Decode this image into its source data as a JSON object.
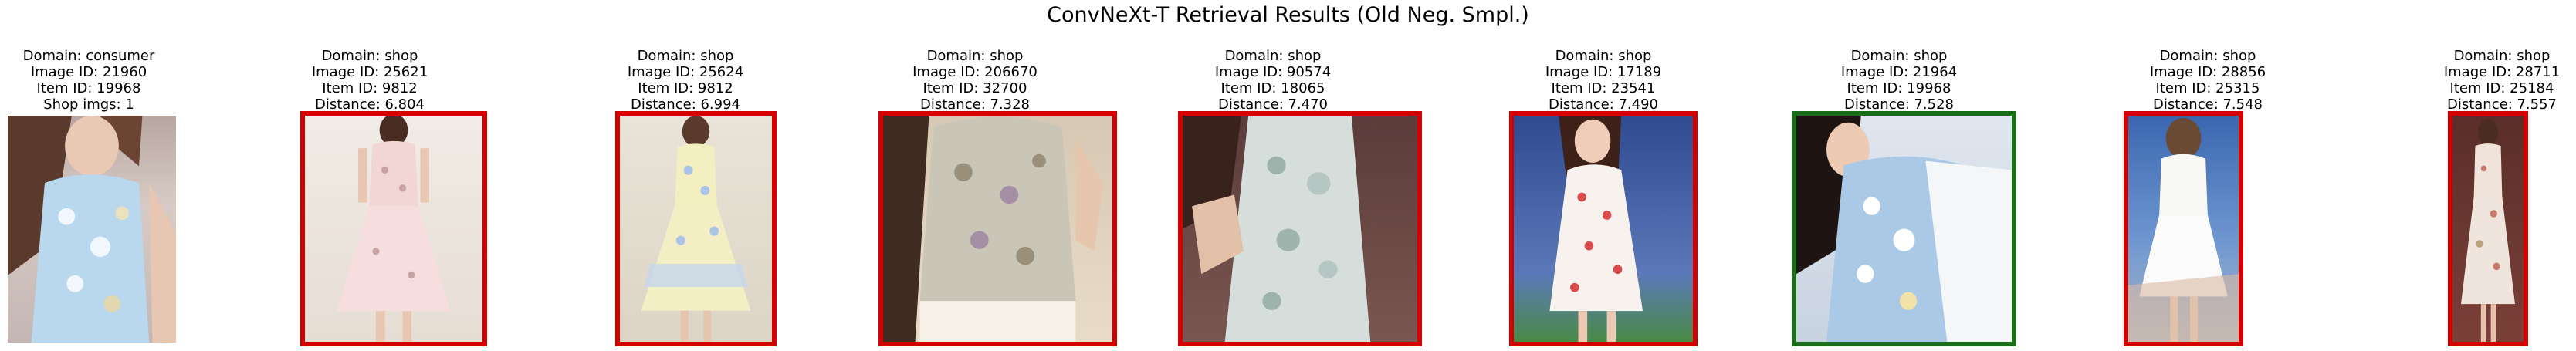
{
  "title": "ConvNeXt-T Retrieval Results (Old Neg. Smpl.)",
  "colors": {
    "wrong_match": "#d40000",
    "correct_match": "#1a6e1a"
  },
  "query": {
    "domain": "Domain: consumer",
    "image_id": "Image ID: 21960",
    "item_id": "Item ID: 19968",
    "shop_imgs": "Shop imgs: 1"
  },
  "results": [
    {
      "domain": "Domain: shop",
      "image_id": "Image ID: 25621",
      "item_id": "Item ID: 9812",
      "distance": "Distance: 6.804",
      "match": "wrong"
    },
    {
      "domain": "Domain: shop",
      "image_id": "Image ID: 25624",
      "item_id": "Item ID: 9812",
      "distance": "Distance: 6.994",
      "match": "wrong"
    },
    {
      "domain": "Domain: shop",
      "image_id": "Image ID: 206670",
      "item_id": "Item ID: 32700",
      "distance": "Distance: 7.328",
      "match": "wrong"
    },
    {
      "domain": "Domain: shop",
      "image_id": "Image ID: 90574",
      "item_id": "Item ID: 18065",
      "distance": "Distance: 7.470",
      "match": "wrong"
    },
    {
      "domain": "Domain: shop",
      "image_id": "Image ID: 17189",
      "item_id": "Item ID: 23541",
      "distance": "Distance: 7.490",
      "match": "wrong"
    },
    {
      "domain": "Domain: shop",
      "image_id": "Image ID: 21964",
      "item_id": "Item ID: 19968",
      "distance": "Distance: 7.528",
      "match": "correct"
    },
    {
      "domain": "Domain: shop",
      "image_id": "Image ID: 28856",
      "item_id": "Item ID: 25315",
      "distance": "Distance: 7.548",
      "match": "wrong"
    },
    {
      "domain": "Domain: shop",
      "image_id": "Image ID: 28711",
      "item_id": "Item ID: 25184",
      "distance": "Distance: 7.557",
      "match": "wrong"
    }
  ]
}
